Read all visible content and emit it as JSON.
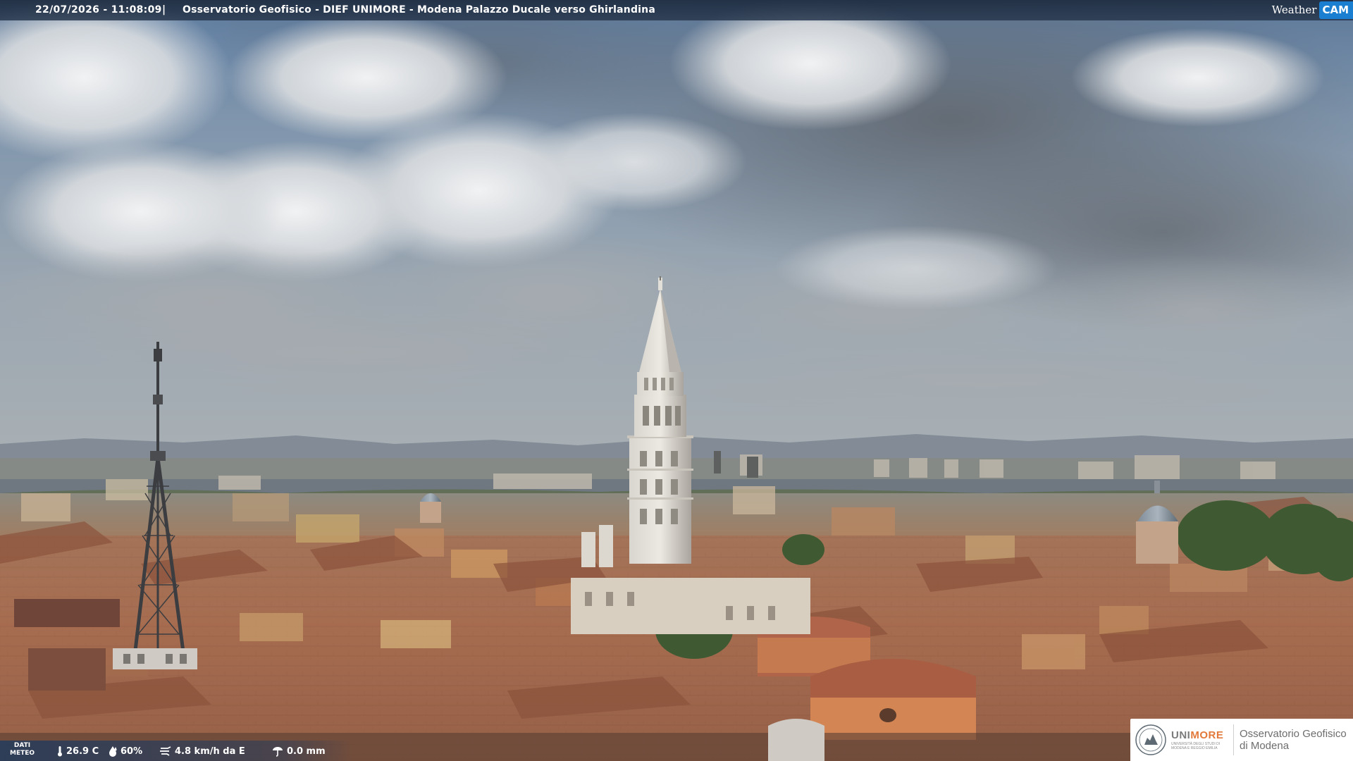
{
  "overlay": {
    "timestamp": "22/07/2026 - 11:08:09",
    "separator": "|",
    "location": "Osservatorio Geofisico - DIEF UNIMORE - Modena Palazzo Ducale verso Ghirlandina",
    "brand_weather": "Weather",
    "brand_cam": "CAM"
  },
  "weather": {
    "label_line1": "DATI",
    "label_line2": "METEO",
    "temperature": "26.9 C",
    "humidity": "60%",
    "wind": "4.8 km/h da E",
    "rain": "0.0 mm",
    "icons": [
      "thermometer-icon",
      "humidity-icon",
      "wind-icon",
      "rain-gauge-icon"
    ]
  },
  "logo": {
    "university_prefix": "UNI",
    "university_suffix": "MORE",
    "university_sub": "UNIVERSITÀ DEGLI STUDI DI MODENA E REGGIO EMILIA",
    "observatory_line1": "Osservatorio Geofisico",
    "observatory_line2": "di Modena"
  },
  "colors": {
    "topbar": "#1e2c40",
    "cam_badge": "#1b7fd1",
    "unimore_accent": "#e2793a",
    "roof_terracotta": "#b06a4c",
    "sky_blue": "#6d8fb3",
    "cloud_grey": "#7b8086"
  }
}
